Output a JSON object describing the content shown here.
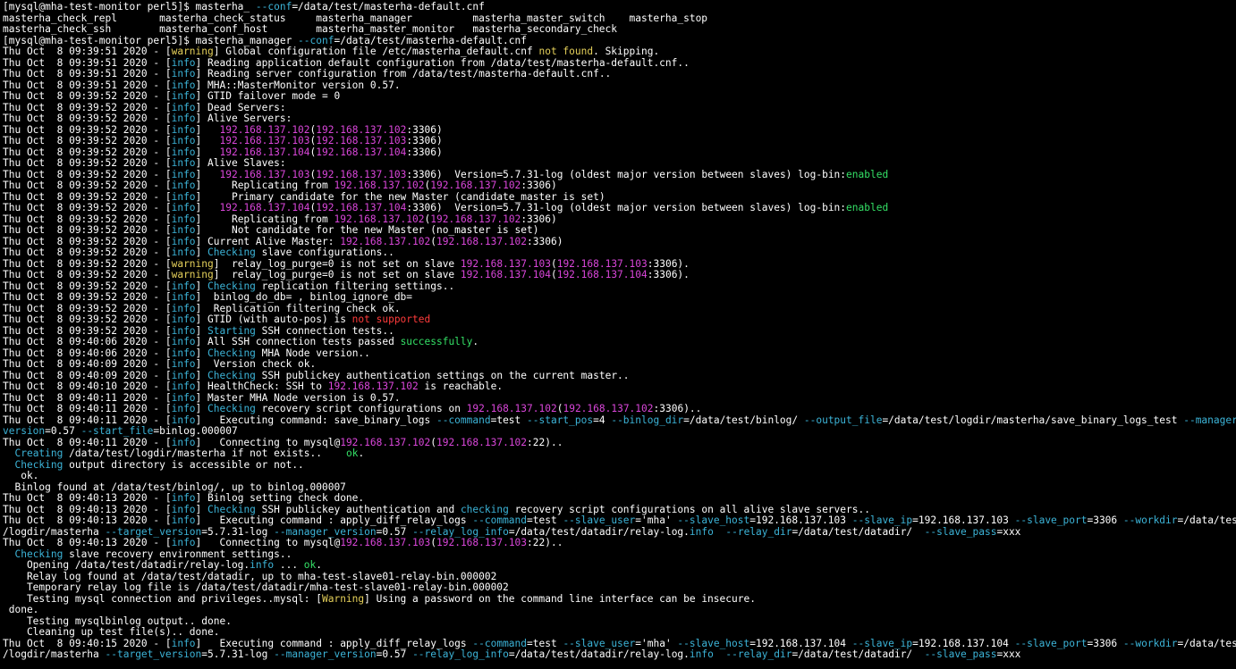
{
  "colors": {
    "background": "#000000",
    "text": "#ffffff",
    "yellow": "#e5d05a",
    "cyan": "#3cb4d8",
    "magenta": "#d946d9",
    "green": "#34e066",
    "red": "#ff3b3b"
  },
  "lines": [
    [
      [
        "[mysql@mha-test-monitor perl5]$ masterha_ ",
        ""
      ],
      [
        "--conf",
        "cyan"
      ],
      [
        "=/data/test/masterha-default.cnf",
        ""
      ]
    ],
    [
      [
        "masterha_check_repl       masterha_check_status     masterha_manager          masterha_master_switch    masterha_stop",
        ""
      ]
    ],
    [
      [
        "masterha_check_ssh        masterha_conf_host        masterha_master_monitor   masterha_secondary_check",
        ""
      ]
    ],
    [
      [
        "[mysql@mha-test-monitor perl5]$ masterha_manager ",
        ""
      ],
      [
        "--conf",
        "cyan"
      ],
      [
        "=/data/test/masterha-default.cnf",
        ""
      ]
    ],
    [
      [
        "Thu Oct  8 09:39:51 2020 - [",
        ""
      ],
      [
        "warning",
        "yellow"
      ],
      [
        "] Global configuration file /etc/masterha_default.cnf ",
        ""
      ],
      [
        "not found",
        "yellow"
      ],
      [
        ". Skipping.",
        ""
      ]
    ],
    [
      [
        "Thu Oct  8 09:39:51 2020 - [",
        ""
      ],
      [
        "info",
        "cyan"
      ],
      [
        "] Reading application default configuration from /data/test/masterha-default.cnf..",
        ""
      ]
    ],
    [
      [
        "Thu Oct  8 09:39:51 2020 - [",
        ""
      ],
      [
        "info",
        "cyan"
      ],
      [
        "] Reading server configuration from /data/test/masterha-default.cnf..",
        ""
      ]
    ],
    [
      [
        "Thu Oct  8 09:39:51 2020 - [",
        ""
      ],
      [
        "info",
        "cyan"
      ],
      [
        "] MHA::MasterMonitor version 0.57.",
        ""
      ]
    ],
    [
      [
        "Thu Oct  8 09:39:52 2020 - [",
        ""
      ],
      [
        "info",
        "cyan"
      ],
      [
        "] GTID failover mode = 0",
        ""
      ]
    ],
    [
      [
        "Thu Oct  8 09:39:52 2020 - [",
        ""
      ],
      [
        "info",
        "cyan"
      ],
      [
        "] Dead Servers:",
        ""
      ]
    ],
    [
      [
        "Thu Oct  8 09:39:52 2020 - [",
        ""
      ],
      [
        "info",
        "cyan"
      ],
      [
        "] Alive Servers:",
        ""
      ]
    ],
    [
      [
        "Thu Oct  8 09:39:52 2020 - [",
        ""
      ],
      [
        "info",
        "cyan"
      ],
      [
        "]   ",
        ""
      ],
      [
        "192.168.137.102",
        "magenta"
      ],
      [
        "(",
        ""
      ],
      [
        "192.168.137.102",
        "magenta"
      ],
      [
        ":3306)",
        ""
      ]
    ],
    [
      [
        "Thu Oct  8 09:39:52 2020 - [",
        ""
      ],
      [
        "info",
        "cyan"
      ],
      [
        "]   ",
        ""
      ],
      [
        "192.168.137.103",
        "magenta"
      ],
      [
        "(",
        ""
      ],
      [
        "192.168.137.103",
        "magenta"
      ],
      [
        ":3306)",
        ""
      ]
    ],
    [
      [
        "Thu Oct  8 09:39:52 2020 - [",
        ""
      ],
      [
        "info",
        "cyan"
      ],
      [
        "]   ",
        ""
      ],
      [
        "192.168.137.104",
        "magenta"
      ],
      [
        "(",
        ""
      ],
      [
        "192.168.137.104",
        "magenta"
      ],
      [
        ":3306)",
        ""
      ]
    ],
    [
      [
        "Thu Oct  8 09:39:52 2020 - [",
        ""
      ],
      [
        "info",
        "cyan"
      ],
      [
        "] Alive Slaves:",
        ""
      ]
    ],
    [
      [
        "Thu Oct  8 09:39:52 2020 - [",
        ""
      ],
      [
        "info",
        "cyan"
      ],
      [
        "]   ",
        ""
      ],
      [
        "192.168.137.103",
        "magenta"
      ],
      [
        "(",
        ""
      ],
      [
        "192.168.137.103",
        "magenta"
      ],
      [
        ":3306)  Version=5.7.31-log (oldest major version between slaves) log-bin:",
        ""
      ],
      [
        "enabled",
        "green"
      ]
    ],
    [
      [
        "Thu Oct  8 09:39:52 2020 - [",
        ""
      ],
      [
        "info",
        "cyan"
      ],
      [
        "]     Replicating from ",
        ""
      ],
      [
        "192.168.137.102",
        "magenta"
      ],
      [
        "(",
        ""
      ],
      [
        "192.168.137.102",
        "magenta"
      ],
      [
        ":3306)",
        ""
      ]
    ],
    [
      [
        "Thu Oct  8 09:39:52 2020 - [",
        ""
      ],
      [
        "info",
        "cyan"
      ],
      [
        "]     Primary candidate for the new Master (candidate_master is set)",
        ""
      ]
    ],
    [
      [
        "Thu Oct  8 09:39:52 2020 - [",
        ""
      ],
      [
        "info",
        "cyan"
      ],
      [
        "]   ",
        ""
      ],
      [
        "192.168.137.104",
        "magenta"
      ],
      [
        "(",
        ""
      ],
      [
        "192.168.137.104",
        "magenta"
      ],
      [
        ":3306)  Version=5.7.31-log (oldest major version between slaves) log-bin:",
        ""
      ],
      [
        "enabled",
        "green"
      ]
    ],
    [
      [
        "Thu Oct  8 09:39:52 2020 - [",
        ""
      ],
      [
        "info",
        "cyan"
      ],
      [
        "]     Replicating from ",
        ""
      ],
      [
        "192.168.137.102",
        "magenta"
      ],
      [
        "(",
        ""
      ],
      [
        "192.168.137.102",
        "magenta"
      ],
      [
        ":3306)",
        ""
      ]
    ],
    [
      [
        "Thu Oct  8 09:39:52 2020 - [",
        ""
      ],
      [
        "info",
        "cyan"
      ],
      [
        "]     Not candidate for the new Master (no_master is set)",
        ""
      ]
    ],
    [
      [
        "Thu Oct  8 09:39:52 2020 - [",
        ""
      ],
      [
        "info",
        "cyan"
      ],
      [
        "] Current Alive Master: ",
        ""
      ],
      [
        "192.168.137.102",
        "magenta"
      ],
      [
        "(",
        ""
      ],
      [
        "192.168.137.102",
        "magenta"
      ],
      [
        ":3306)",
        ""
      ]
    ],
    [
      [
        "Thu Oct  8 09:39:52 2020 - [",
        ""
      ],
      [
        "info",
        "cyan"
      ],
      [
        "] ",
        ""
      ],
      [
        "Checking",
        "cyan"
      ],
      [
        " slave configurations..",
        ""
      ]
    ],
    [
      [
        "Thu Oct  8 09:39:52 2020 - [",
        ""
      ],
      [
        "warning",
        "yellow"
      ],
      [
        "]  relay_log_purge=0 is not set on slave ",
        ""
      ],
      [
        "192.168.137.103",
        "magenta"
      ],
      [
        "(",
        ""
      ],
      [
        "192.168.137.103",
        "magenta"
      ],
      [
        ":3306).",
        ""
      ]
    ],
    [
      [
        "Thu Oct  8 09:39:52 2020 - [",
        ""
      ],
      [
        "warning",
        "yellow"
      ],
      [
        "]  relay_log_purge=0 is not set on slave ",
        ""
      ],
      [
        "192.168.137.104",
        "magenta"
      ],
      [
        "(",
        ""
      ],
      [
        "192.168.137.104",
        "magenta"
      ],
      [
        ":3306).",
        ""
      ]
    ],
    [
      [
        "Thu Oct  8 09:39:52 2020 - [",
        ""
      ],
      [
        "info",
        "cyan"
      ],
      [
        "] ",
        ""
      ],
      [
        "Checking",
        "cyan"
      ],
      [
        " replication filtering settings..",
        ""
      ]
    ],
    [
      [
        "Thu Oct  8 09:39:52 2020 - [",
        ""
      ],
      [
        "info",
        "cyan"
      ],
      [
        "]  binlog_do_db= , binlog_ignore_db=",
        ""
      ]
    ],
    [
      [
        "Thu Oct  8 09:39:52 2020 - [",
        ""
      ],
      [
        "info",
        "cyan"
      ],
      [
        "]  Replication filtering check ok.",
        ""
      ]
    ],
    [
      [
        "Thu Oct  8 09:39:52 2020 - [",
        ""
      ],
      [
        "info",
        "cyan"
      ],
      [
        "] GTID (with auto-pos) is ",
        ""
      ],
      [
        "not supported",
        "red"
      ]
    ],
    [
      [
        "Thu Oct  8 09:39:52 2020 - [",
        ""
      ],
      [
        "info",
        "cyan"
      ],
      [
        "] ",
        ""
      ],
      [
        "Starting",
        "cyan"
      ],
      [
        " SSH connection tests..",
        ""
      ]
    ],
    [
      [
        "Thu Oct  8 09:40:06 2020 - [",
        ""
      ],
      [
        "info",
        "cyan"
      ],
      [
        "] All SSH connection tests passed ",
        ""
      ],
      [
        "successfully",
        "green"
      ],
      [
        ".",
        ""
      ]
    ],
    [
      [
        "Thu Oct  8 09:40:06 2020 - [",
        ""
      ],
      [
        "info",
        "cyan"
      ],
      [
        "] ",
        ""
      ],
      [
        "Checking",
        "cyan"
      ],
      [
        " MHA Node version..",
        ""
      ]
    ],
    [
      [
        "Thu Oct  8 09:40:09 2020 - [",
        ""
      ],
      [
        "info",
        "cyan"
      ],
      [
        "]  Version check ok.",
        ""
      ]
    ],
    [
      [
        "Thu Oct  8 09:40:09 2020 - [",
        ""
      ],
      [
        "info",
        "cyan"
      ],
      [
        "] ",
        ""
      ],
      [
        "Checking",
        "cyan"
      ],
      [
        " SSH publickey authentication settings on the current master..",
        ""
      ]
    ],
    [
      [
        "Thu Oct  8 09:40:10 2020 - [",
        ""
      ],
      [
        "info",
        "cyan"
      ],
      [
        "] HealthCheck: SSH to ",
        ""
      ],
      [
        "192.168.137.102",
        "magenta"
      ],
      [
        " is reachable.",
        ""
      ]
    ],
    [
      [
        "Thu Oct  8 09:40:11 2020 - [",
        ""
      ],
      [
        "info",
        "cyan"
      ],
      [
        "] Master MHA Node version is 0.57.",
        ""
      ]
    ],
    [
      [
        "Thu Oct  8 09:40:11 2020 - [",
        ""
      ],
      [
        "info",
        "cyan"
      ],
      [
        "] ",
        ""
      ],
      [
        "Checking",
        "cyan"
      ],
      [
        " recovery script configurations on ",
        ""
      ],
      [
        "192.168.137.102",
        "magenta"
      ],
      [
        "(",
        ""
      ],
      [
        "192.168.137.102",
        "magenta"
      ],
      [
        ":3306)..",
        ""
      ]
    ],
    [
      [
        "Thu Oct  8 09:40:11 2020 - [",
        ""
      ],
      [
        "info",
        "cyan"
      ],
      [
        "]   Executing command: save_binary_logs ",
        ""
      ],
      [
        "--command",
        "cyan"
      ],
      [
        "=test ",
        ""
      ],
      [
        "--start_pos",
        "cyan"
      ],
      [
        "=4 ",
        ""
      ],
      [
        "--binlog_dir",
        "cyan"
      ],
      [
        "=/data/test/binlog/ ",
        ""
      ],
      [
        "--output_file",
        "cyan"
      ],
      [
        "=/data/test/logdir/masterha/save_binary_logs_test ",
        ""
      ],
      [
        "--manager_",
        "cyan"
      ]
    ],
    [
      [
        "version",
        "cyan"
      ],
      [
        "=0.57 ",
        ""
      ],
      [
        "--start_file",
        "cyan"
      ],
      [
        "=binlog.000007",
        ""
      ]
    ],
    [
      [
        "Thu Oct  8 09:40:11 2020 - [",
        ""
      ],
      [
        "info",
        "cyan"
      ],
      [
        "]   Connecting to mysql@",
        ""
      ],
      [
        "192.168.137.102",
        "magenta"
      ],
      [
        "(",
        ""
      ],
      [
        "192.168.137.102",
        "magenta"
      ],
      [
        ":22)..",
        ""
      ]
    ],
    [
      [
        "  ",
        ""
      ],
      [
        "Creating",
        "cyan"
      ],
      [
        " /data/test/logdir/masterha if not exists..    ",
        ""
      ],
      [
        "ok",
        "green"
      ],
      [
        ".",
        ""
      ]
    ],
    [
      [
        "  ",
        ""
      ],
      [
        "Checking",
        "cyan"
      ],
      [
        " output directory is accessible or not..",
        ""
      ]
    ],
    [
      [
        "   ok.",
        ""
      ]
    ],
    [
      [
        "  Binlog found at /data/test/binlog/, up to binlog.000007",
        ""
      ]
    ],
    [
      [
        "Thu Oct  8 09:40:13 2020 - [",
        ""
      ],
      [
        "info",
        "cyan"
      ],
      [
        "] Binlog setting check done.",
        ""
      ]
    ],
    [
      [
        "Thu Oct  8 09:40:13 2020 - [",
        ""
      ],
      [
        "info",
        "cyan"
      ],
      [
        "] ",
        ""
      ],
      [
        "Checking",
        "cyan"
      ],
      [
        " SSH publickey authentication and ",
        ""
      ],
      [
        "checking",
        "cyan"
      ],
      [
        " recovery script configurations on all alive slave servers..",
        ""
      ]
    ],
    [
      [
        "Thu Oct  8 09:40:13 2020 - [",
        ""
      ],
      [
        "info",
        "cyan"
      ],
      [
        "]   Executing command : apply_diff_relay_logs ",
        ""
      ],
      [
        "--command",
        "cyan"
      ],
      [
        "=test ",
        ""
      ],
      [
        "--slave_user",
        "cyan"
      ],
      [
        "='mha' ",
        ""
      ],
      [
        "--slave_host",
        "cyan"
      ],
      [
        "=192.168.137.103 ",
        ""
      ],
      [
        "--slave_ip",
        "cyan"
      ],
      [
        "=192.168.137.103 ",
        ""
      ],
      [
        "--slave_port",
        "cyan"
      ],
      [
        "=3306 ",
        ""
      ],
      [
        "--workdir",
        "cyan"
      ],
      [
        "=/data/test",
        ""
      ]
    ],
    [
      [
        "/logdir/masterha ",
        ""
      ],
      [
        "--target_version",
        "cyan"
      ],
      [
        "=5.7.31-log ",
        ""
      ],
      [
        "--manager_version",
        "cyan"
      ],
      [
        "=0.57 ",
        ""
      ],
      [
        "--relay_log_info",
        "cyan"
      ],
      [
        "=/data/test/datadir/relay-log.",
        ""
      ],
      [
        "info",
        "cyan"
      ],
      [
        "  ",
        ""
      ],
      [
        "--relay_dir",
        "cyan"
      ],
      [
        "=/data/test/datadir/  ",
        ""
      ],
      [
        "--slave_pass",
        "cyan"
      ],
      [
        "=xxx",
        ""
      ]
    ],
    [
      [
        "Thu Oct  8 09:40:13 2020 - [",
        ""
      ],
      [
        "info",
        "cyan"
      ],
      [
        "]   Connecting to mysql@",
        ""
      ],
      [
        "192.168.137.103",
        "magenta"
      ],
      [
        "(",
        ""
      ],
      [
        "192.168.137.103",
        "magenta"
      ],
      [
        ":22)..",
        ""
      ]
    ],
    [
      [
        "  ",
        ""
      ],
      [
        "Checking",
        "cyan"
      ],
      [
        " slave recovery environment settings..",
        ""
      ]
    ],
    [
      [
        "    Opening /data/test/datadir/relay-log.",
        ""
      ],
      [
        "info",
        "cyan"
      ],
      [
        " ... ",
        ""
      ],
      [
        "ok",
        "green"
      ],
      [
        ".",
        ""
      ]
    ],
    [
      [
        "    Relay log found at /data/test/datadir, up to mha-test-slave01-relay-bin.000002",
        ""
      ]
    ],
    [
      [
        "    Temporary relay log file is /data/test/datadir/mha-test-slave01-relay-bin.000002",
        ""
      ]
    ],
    [
      [
        "    Testing mysql connection and privileges..mysql: [",
        ""
      ],
      [
        "Warning",
        "yellow"
      ],
      [
        "] Using a password on the command line interface can be insecure.",
        ""
      ]
    ],
    [
      [
        " done.",
        ""
      ]
    ],
    [
      [
        "    Testing mysqlbinlog output.. done.",
        ""
      ]
    ],
    [
      [
        "    Cleaning up test file(s).. done.",
        ""
      ]
    ],
    [
      [
        "Thu Oct  8 09:40:15 2020 - [",
        ""
      ],
      [
        "info",
        "cyan"
      ],
      [
        "]   Executing command : apply_diff_relay_logs ",
        ""
      ],
      [
        "--command",
        "cyan"
      ],
      [
        "=test ",
        ""
      ],
      [
        "--slave_user",
        "cyan"
      ],
      [
        "='mha' ",
        ""
      ],
      [
        "--slave_host",
        "cyan"
      ],
      [
        "=192.168.137.104 ",
        ""
      ],
      [
        "--slave_ip",
        "cyan"
      ],
      [
        "=192.168.137.104 ",
        ""
      ],
      [
        "--slave_port",
        "cyan"
      ],
      [
        "=3306 ",
        ""
      ],
      [
        "--workdir",
        "cyan"
      ],
      [
        "=/data/test",
        ""
      ]
    ],
    [
      [
        "/logdir/masterha ",
        ""
      ],
      [
        "--target_version",
        "cyan"
      ],
      [
        "=5.7.31-log ",
        ""
      ],
      [
        "--manager_version",
        "cyan"
      ],
      [
        "=0.57 ",
        ""
      ],
      [
        "--relay_log_info",
        "cyan"
      ],
      [
        "=/data/test/datadir/relay-log.",
        ""
      ],
      [
        "info",
        "cyan"
      ],
      [
        "  ",
        ""
      ],
      [
        "--relay_dir",
        "cyan"
      ],
      [
        "=/data/test/datadir/  ",
        ""
      ],
      [
        "--slave_pass",
        "cyan"
      ],
      [
        "=xxx",
        ""
      ]
    ]
  ]
}
